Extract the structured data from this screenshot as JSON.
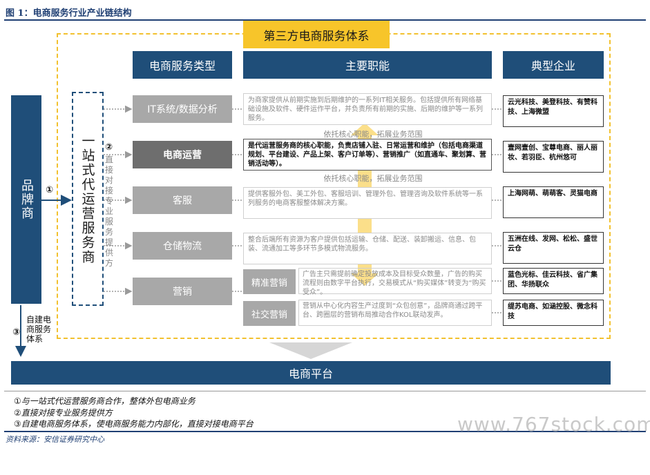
{
  "figure_title": "图 1：电商服务行业产业链结构",
  "banner": "第三方电商服务体系",
  "headers": {
    "type": "电商服务类型",
    "function": "主要职能",
    "enterprise": "典型企业"
  },
  "brand": "品牌商",
  "one_stop": "一站式代运营服务商",
  "direct_label": "直接对接专业服务提供方",
  "markers": {
    "m1": "①",
    "m2": "②",
    "m3": "③"
  },
  "self_built": "自建电商服务体系",
  "rows": [
    {
      "type": "IT系统/数据分析",
      "desc": "为商家提供从前期实施到后期维护的一系列IT相关服务。包括提供所有网络基础设施及软件、硬件运作平台，并负责所有前期的实施、后期的维护等一系列服务。",
      "ent": "云光科技、美登科技、有赞科技、上海微盟"
    },
    {
      "type": "电商运营",
      "desc": "是代运营服务商的核心职能，负责店铺入驻、日常运营和维护（包括电商渠道规划、平台建设、产品上架、客户订单等）、营销推广（如直通车、聚划算、营销活动等）。",
      "ent": "壹网壹创、宝尊电商、丽人丽妆、若羽臣、杭州悠可"
    },
    {
      "type": "客服",
      "desc": "提供客服外包、美工外包、客服培训、管理外包、管理咨询及软件系统等一系列服务的电商客服整体解决方案。",
      "ent": "上海网萌、萌萌客、灵猫电商"
    },
    {
      "type": "仓储物流",
      "desc": "整合后端所有资源为客户提供包括运输、仓储、配送、装卸搬运、信息、包装、流通加工等多环节多模式物流服务。",
      "ent": "五洲在线、发网、松松、盛世云仓"
    }
  ],
  "mid_notes": [
    "依托核心职能，拓展业务范围",
    "依托核心职能，拓展业务范围"
  ],
  "marketing": {
    "type": "营销",
    "subs": [
      {
        "name": "精准营销",
        "desc": "广告主只需提前确定投放成本及目标受众数量，广告的购买流程则由数字平台执行，交易模式从“购买媒体”转变为“购买受众”。",
        "ent": "蓝色光标、佳云科技、省广集团、华扬联众"
      },
      {
        "name": "社交营销",
        "desc": "营销从中心化内容生产过度到“众包创意”，品牌商通过跨平台、跨圈层的营销布局推动合作KOL联动发声。",
        "ent": "缇苏电商、如涵控股、微念科技"
      }
    ]
  },
  "platform": "电商平台",
  "footnotes": [
    "①与一站式代运营服务商合作，整体外包电商业务",
    "②直接对接专业服务提供方",
    "③自建电商服务体系，使电商服务能力内部化，直接对接电商平台"
  ],
  "source": "资料来源：安信证券研究中心",
  "watermark": "www.767stock.com",
  "colors": {
    "navy": "#1f4e79",
    "gold": "#f7c52a",
    "gray": "#a8a8a8"
  }
}
